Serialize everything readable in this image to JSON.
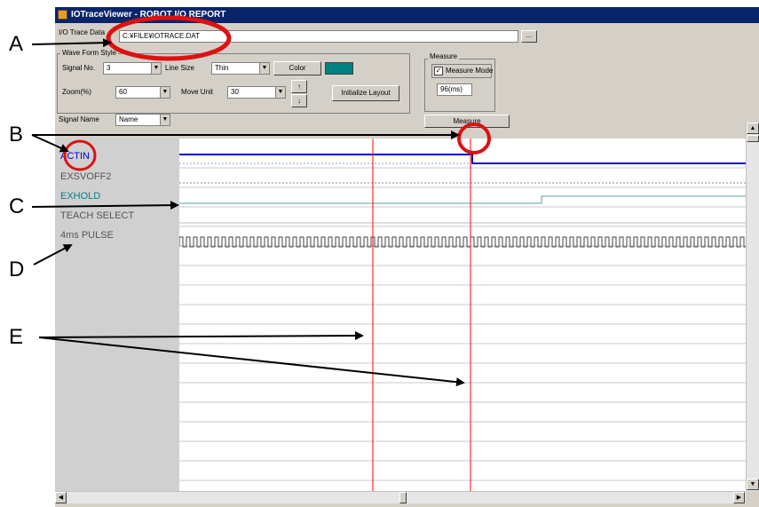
{
  "window": {
    "title": "IOTraceViewer - ROBOT I/O REPORT"
  },
  "file": {
    "label": "I/O Trace Data",
    "path": "C:¥FILE¥IOTRACE.DAT",
    "browse_label": "..."
  },
  "waveform": {
    "group_title": "Wave Form Style",
    "signal_no_label": "Signal No.",
    "signal_no_value": "3",
    "line_size_label": "Line Size",
    "line_size_value": "Thin",
    "color_label": "Color",
    "color_value": "#008080",
    "zoom_label": "Zoom(%)",
    "zoom_value": "60",
    "move_unit_label": "Move Unit",
    "move_unit_value": "30",
    "up_label": "↑",
    "down_label": "↓",
    "init_layout_label": "Initialize Layout"
  },
  "measure": {
    "group_title": "Measure",
    "mode_label": "Measure Mode",
    "mode_checked": "✓",
    "result": "96(ms)"
  },
  "signal_name": {
    "label": "Signal Name",
    "value": "Name"
  },
  "measure_button_label": "Measure",
  "signals": [
    {
      "label": "ACTIN",
      "color": "#0000cc"
    },
    {
      "label": "EXSVOFF2",
      "color": "#555555"
    },
    {
      "label": "EXHOLD",
      "color": "#008080"
    },
    {
      "label": "TEACH SELECT",
      "color": "#555555"
    },
    {
      "label": "4ms PULSE",
      "color": "#555555"
    }
  ],
  "callouts": {
    "a": "A",
    "b": "B",
    "c": "C",
    "d": "D",
    "e": "E"
  },
  "colors": {
    "cursor": "#ff0000",
    "callout_ring": "#dd1111",
    "chart_bg": "#ffffff",
    "label_bg": "#d0d0d0"
  }
}
